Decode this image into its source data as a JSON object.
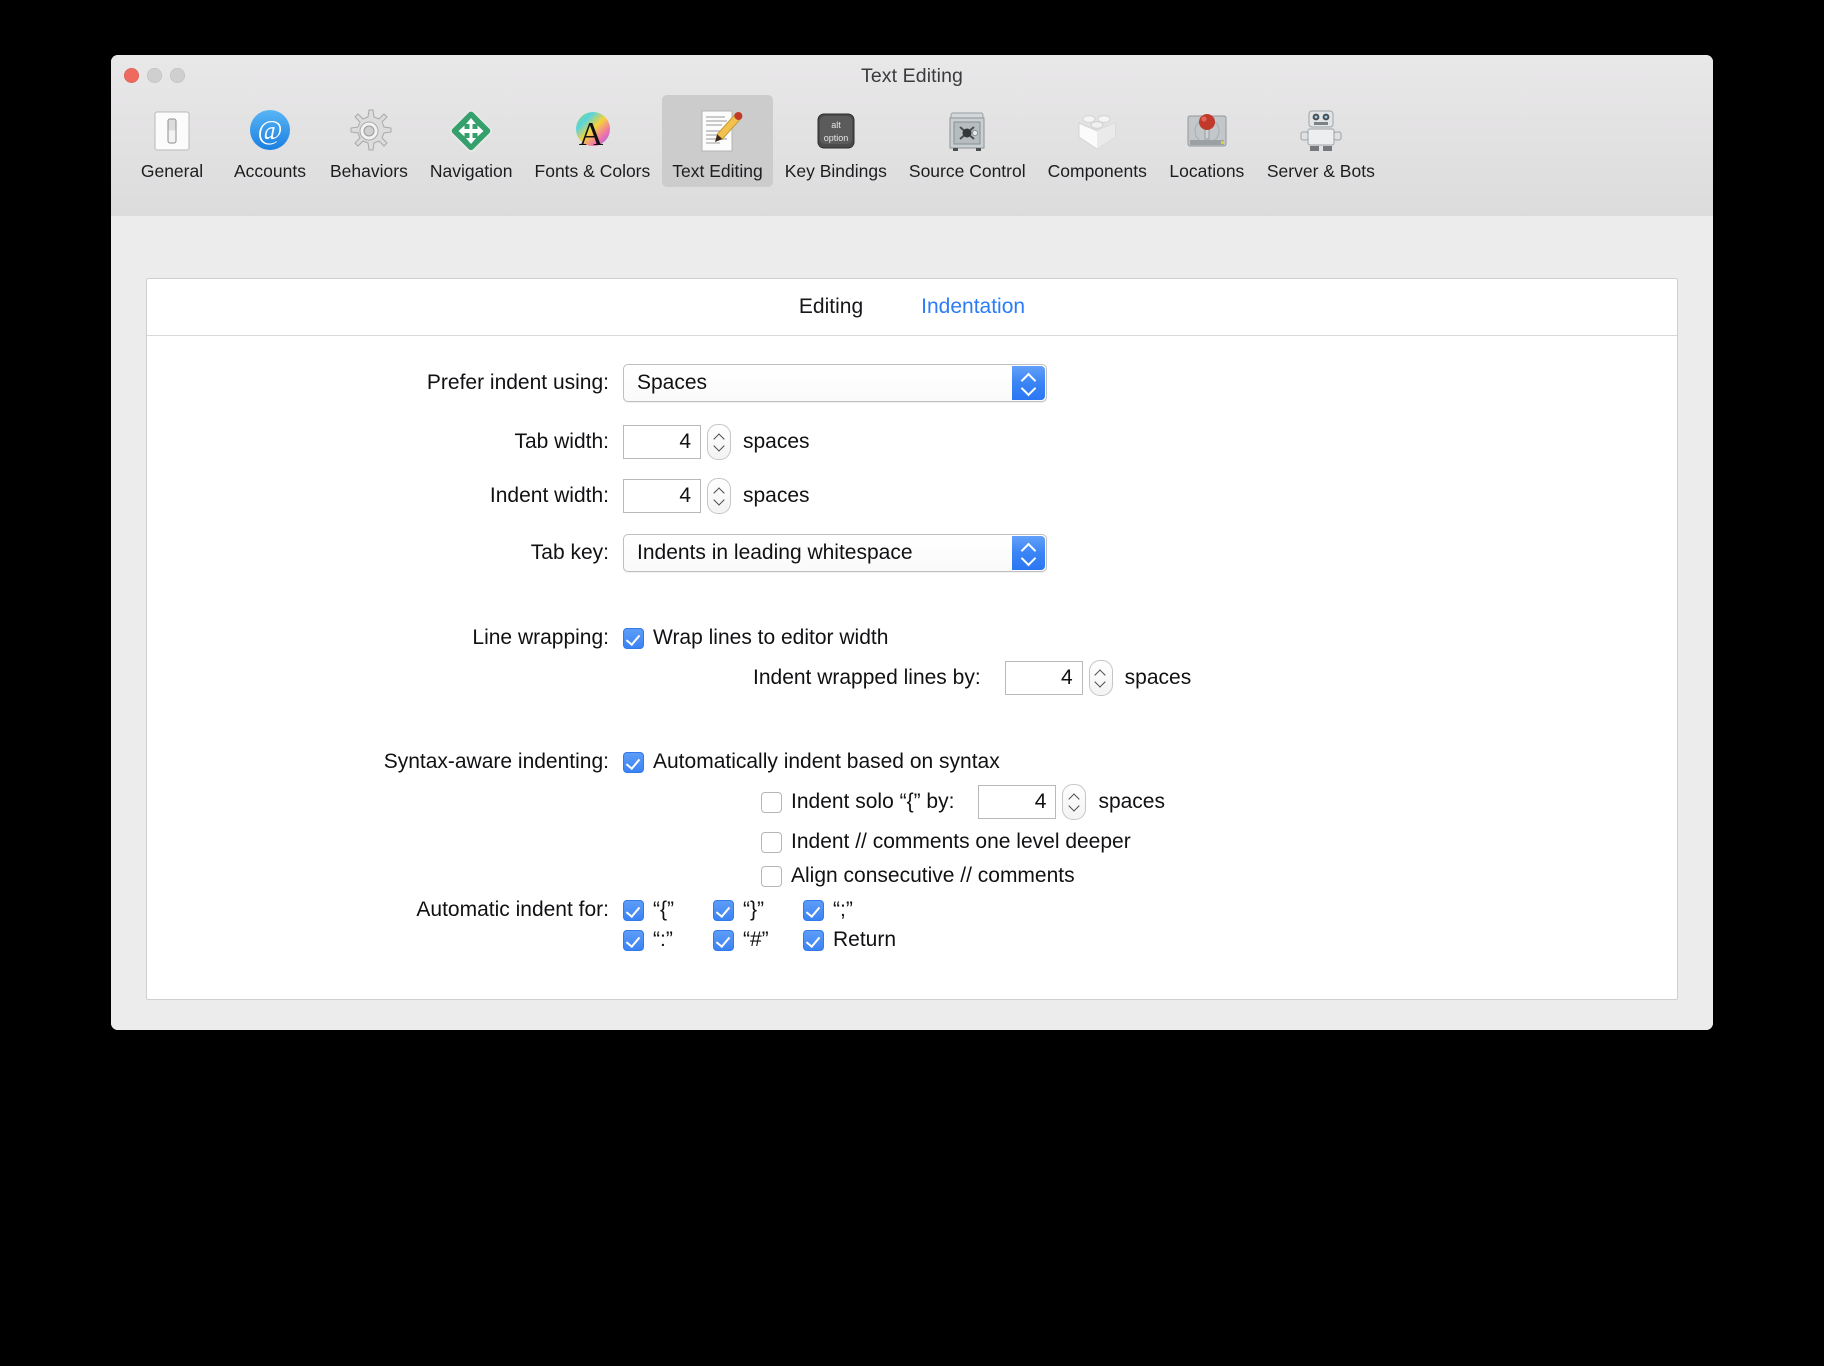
{
  "window": {
    "title": "Text Editing",
    "traffic_lights": [
      "close-button",
      "minimize-button",
      "zoom-button"
    ]
  },
  "toolbar": {
    "items": [
      {
        "label": "General",
        "icon": "general-switch-icon",
        "selected": false
      },
      {
        "label": "Accounts",
        "icon": "at-sign-icon",
        "selected": false
      },
      {
        "label": "Behaviors",
        "icon": "gear-icon",
        "selected": false
      },
      {
        "label": "Navigation",
        "icon": "arrows-diamond-icon",
        "selected": false
      },
      {
        "label": "Fonts & Colors",
        "icon": "font-color-a-icon",
        "selected": false
      },
      {
        "label": "Text Editing",
        "icon": "document-pencil-icon",
        "selected": true
      },
      {
        "label": "Key Bindings",
        "icon": "alt-option-key-icon",
        "selected": false
      },
      {
        "label": "Source Control",
        "icon": "safe-vault-icon",
        "selected": false
      },
      {
        "label": "Components",
        "icon": "lego-block-icon",
        "selected": false
      },
      {
        "label": "Locations",
        "icon": "hard-drive-pin-icon",
        "selected": false
      },
      {
        "label": "Server & Bots",
        "icon": "robot-icon",
        "selected": false
      }
    ]
  },
  "tabs": [
    {
      "label": "Editing",
      "active": false
    },
    {
      "label": "Indentation",
      "active": true
    }
  ],
  "form": {
    "prefer_indent": {
      "label": "Prefer indent using:",
      "value": "Spaces"
    },
    "tab_width": {
      "label": "Tab width:",
      "value": "4",
      "unit": "spaces"
    },
    "indent_width": {
      "label": "Indent width:",
      "value": "4",
      "unit": "spaces"
    },
    "tab_key": {
      "label": "Tab key:",
      "value": "Indents in leading whitespace"
    },
    "line_wrapping": {
      "label": "Line wrapping:",
      "wrap_lines": {
        "label": "Wrap lines to editor width",
        "checked": true
      },
      "indent_wrapped": {
        "label": "Indent wrapped lines by:",
        "value": "4",
        "unit": "spaces"
      }
    },
    "syntax_aware": {
      "label": "Syntax-aware indenting:",
      "auto_indent": {
        "label": "Automatically indent based on syntax",
        "checked": true
      },
      "indent_solo": {
        "label": "Indent solo “{” by:",
        "checked": false,
        "value": "4",
        "unit": "spaces"
      },
      "indent_comments": {
        "label": "Indent // comments one level deeper",
        "checked": false
      },
      "align_comments": {
        "label": "Align consecutive // comments",
        "checked": false
      }
    },
    "automatic_indent": {
      "label": "Automatic indent for:",
      "row1": [
        {
          "label": "“{”",
          "checked": true
        },
        {
          "label": "“}”",
          "checked": true
        },
        {
          "label": "“;”",
          "checked": true
        }
      ],
      "row2": [
        {
          "label": "“:”",
          "checked": true
        },
        {
          "label": "“#”",
          "checked": true
        },
        {
          "label": "Return",
          "checked": true
        }
      ]
    }
  },
  "colors": {
    "accent_blue": "#3b83f4",
    "tab_active": "#2b7cf6",
    "window_bg": "#ececec",
    "panel_bg": "#ffffff",
    "close_red": "#ee6a5f"
  }
}
